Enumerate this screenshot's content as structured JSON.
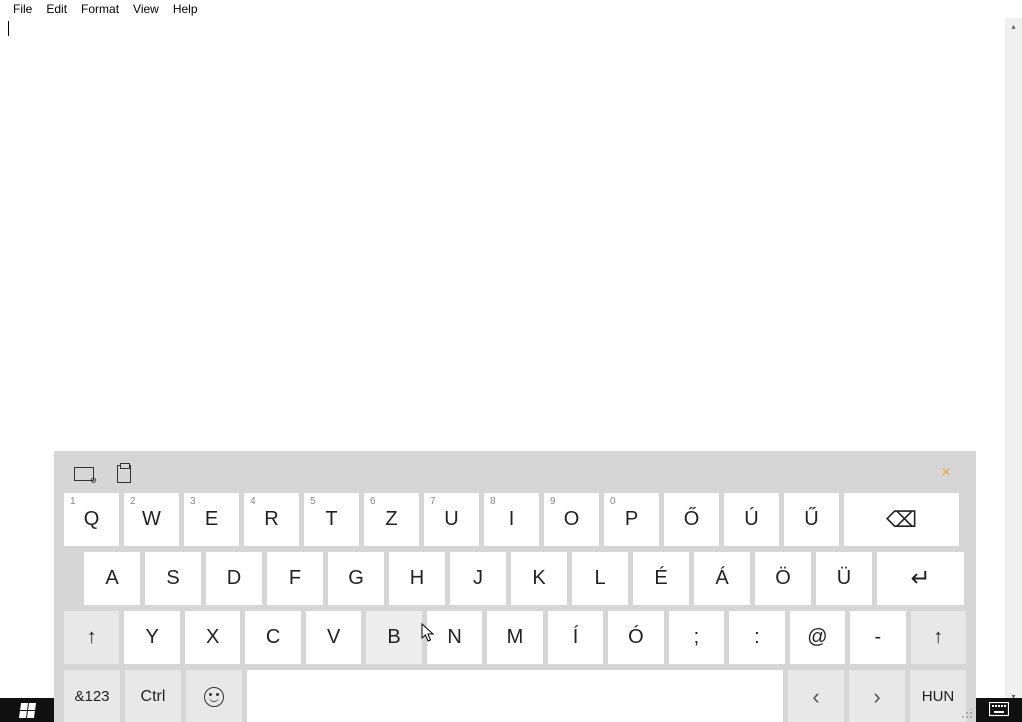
{
  "menubar": {
    "items": [
      "File",
      "Edit",
      "Format",
      "View",
      "Help"
    ]
  },
  "editor": {
    "content": ""
  },
  "osk": {
    "close_label": "×",
    "row1": [
      {
        "sup": "1",
        "label": "Q"
      },
      {
        "sup": "2",
        "label": "W"
      },
      {
        "sup": "3",
        "label": "E"
      },
      {
        "sup": "4",
        "label": "R"
      },
      {
        "sup": "5",
        "label": "T"
      },
      {
        "sup": "6",
        "label": "Z"
      },
      {
        "sup": "7",
        "label": "U"
      },
      {
        "sup": "8",
        "label": "I"
      },
      {
        "sup": "9",
        "label": "O"
      },
      {
        "sup": "0",
        "label": "P"
      },
      {
        "sup": "",
        "label": "Ő"
      },
      {
        "sup": "",
        "label": "Ú"
      },
      {
        "sup": "",
        "label": "Ű"
      }
    ],
    "row2": [
      "A",
      "S",
      "D",
      "F",
      "G",
      "H",
      "J",
      "K",
      "L",
      "É",
      "Á",
      "Ö",
      "Ü"
    ],
    "row3": [
      "Y",
      "X",
      "C",
      "V",
      "B",
      "N",
      "M",
      "Í",
      "Ó",
      ";",
      ":",
      "@",
      "-"
    ],
    "row4": {
      "symbols": "&123",
      "ctrl": "Ctrl",
      "left": "‹",
      "right": "›",
      "lang": "HUN"
    }
  }
}
